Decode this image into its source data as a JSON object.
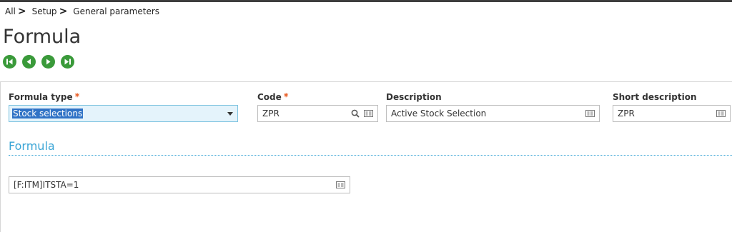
{
  "breadcrumb": {
    "items": [
      "All",
      "Setup",
      "General parameters"
    ]
  },
  "page": {
    "title": "Formula"
  },
  "nav": {
    "icons": [
      "first-record-icon",
      "previous-record-icon",
      "next-record-icon",
      "last-record-icon"
    ]
  },
  "form": {
    "formula_type": {
      "label": "Formula type",
      "required": "*",
      "value": "Stock selections"
    },
    "code": {
      "label": "Code",
      "required": "*",
      "value": "ZPR"
    },
    "description": {
      "label": "Description",
      "value": "Active Stock Selection"
    },
    "short_description": {
      "label": "Short description",
      "value": "ZPR"
    }
  },
  "formula_section": {
    "title": "Formula",
    "value": "[F:ITM]ITSTA=1"
  },
  "colors": {
    "accent": "#3aa5d6",
    "required": "#e8581e",
    "nav_green": "#3a9a3a",
    "selection": "#3073c6"
  }
}
